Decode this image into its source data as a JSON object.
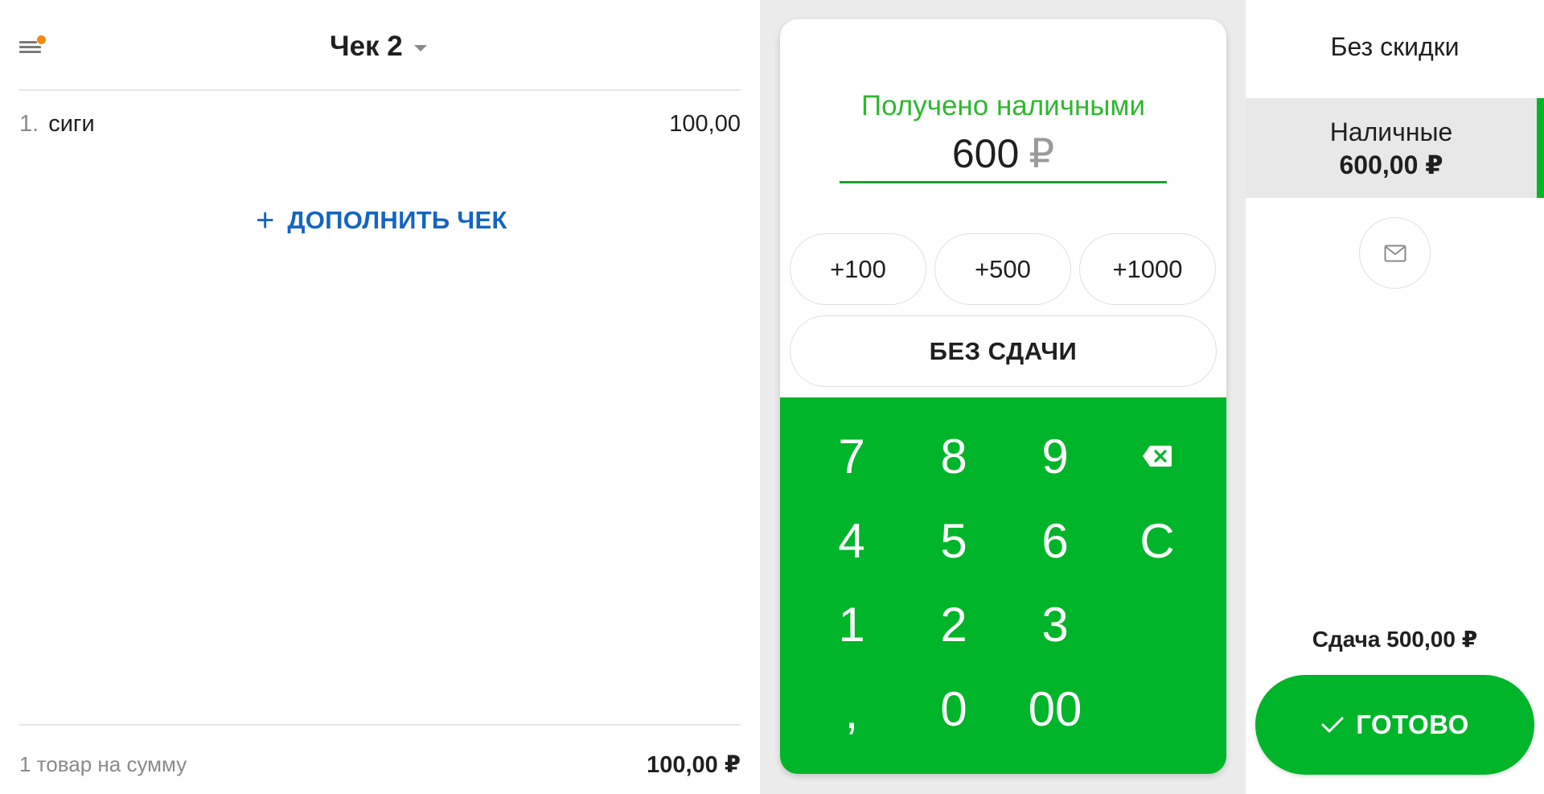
{
  "receipt": {
    "title": "Чек 2",
    "items": [
      {
        "number": "1.",
        "name": "сиги",
        "price": "100,00"
      }
    ],
    "add_label": "ДОПОЛНИТЬ ЧЕК",
    "add_icon": "+",
    "summary_label": "1 товар на сумму",
    "summary_total": "100,00 ₽"
  },
  "payment": {
    "received_label": "Получено наличными",
    "amount": "600",
    "currency": "₽",
    "quick_buttons": [
      "+100",
      "+500",
      "+1000"
    ],
    "no_change_label": "БЕЗ СДАЧИ",
    "keypad": {
      "k7": "7",
      "k8": "8",
      "k9": "9",
      "k4": "4",
      "k5": "5",
      "k6": "6",
      "kc": "C",
      "k1": "1",
      "k2": "2",
      "k3": "3",
      "kcomma": ",",
      "k0": "0",
      "k00": "00"
    }
  },
  "sidebar": {
    "discount_label": "Без скидки",
    "method_label": "Наличные",
    "method_amount": "600,00 ₽",
    "change_label": "Сдача 500,00 ₽",
    "done_label": "ГОТОВО"
  },
  "colors": {
    "accent_green": "#00b52a",
    "label_green": "#2eb82e",
    "link_blue": "#1565c0",
    "notification_orange": "#f08a10"
  }
}
